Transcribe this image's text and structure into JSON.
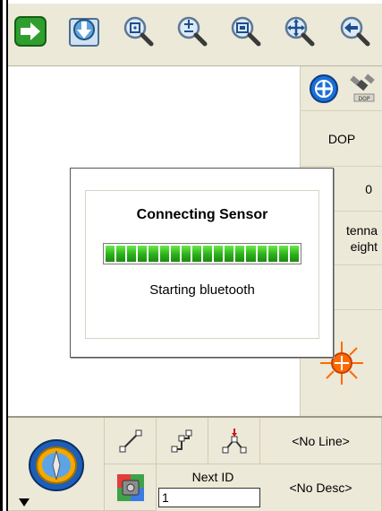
{
  "toolbar": {
    "buttons": [
      {
        "name": "next-arrow-icon"
      },
      {
        "name": "download-icon"
      },
      {
        "name": "zoom-extent-icon"
      },
      {
        "name": "zoom-in-out-icon"
      },
      {
        "name": "zoom-window-icon"
      },
      {
        "name": "pan-icon"
      },
      {
        "name": "back-icon"
      }
    ]
  },
  "right_panel": {
    "dop_label": "DOP",
    "satellite_count": "0",
    "antenna_label_line1": "tenna",
    "antenna_label_line2": "eight"
  },
  "dialog": {
    "title": "Connecting Sensor",
    "status": "Starting bluetooth",
    "progress_fraction": 1.0
  },
  "bottom": {
    "line_select": "<No Line>",
    "desc_select": "<No Desc>",
    "next_id_label": "Next ID",
    "next_id_value": "1"
  },
  "colors": {
    "panel": "#ece9d8",
    "progress_green": "#2bb01a",
    "accent_blue": "#1d6fd6",
    "gps_orange": "#ff6a00"
  }
}
